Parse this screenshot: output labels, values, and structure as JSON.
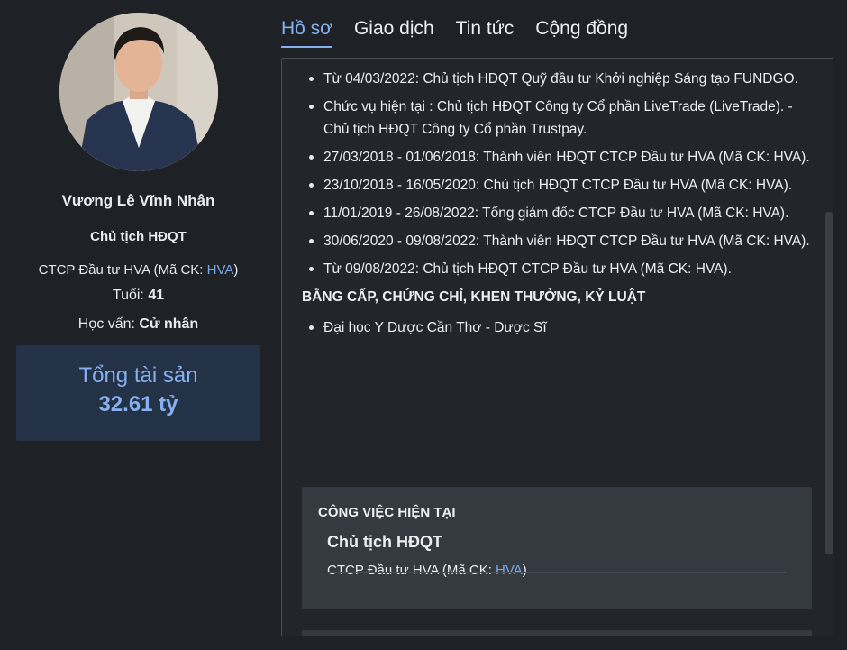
{
  "profile": {
    "name": "Vương Lê Vĩnh Nhân",
    "role": "Chủ tịch HĐQT",
    "company_prefix": "CTCP Đầu tư HVA (Mã CK: ",
    "company_ticker": "HVA",
    "company_suffix": ")",
    "age_label": "Tuổi: ",
    "age_value": "41",
    "education_label": "Học vấn: ",
    "education_value": "Cử nhân",
    "asset_label": "Tổng tài sản",
    "asset_value": "32.61 tỷ"
  },
  "tabs": [
    {
      "label": "Hồ sơ",
      "active": true
    },
    {
      "label": "Giao dịch",
      "active": false
    },
    {
      "label": "Tin tức",
      "active": false
    },
    {
      "label": "Cộng đồng",
      "active": false
    }
  ],
  "career": [
    "Từ 04/03/2022: Chủ tịch HĐQT Quỹ đầu tư Khởi nghiệp Sáng tạo FUNDGO.",
    "Chức vụ hiện tại : Chủ tịch HĐQT Công ty Cổ phần LiveTrade (LiveTrade). - Chủ tịch HĐQT Công ty Cổ phần Trustpay.",
    "27/03/2018 - 01/06/2018: Thành viên HĐQT CTCP Đầu tư HVA (Mã CK: HVA).",
    "23/10/2018 - 16/05/2020: Chủ tịch HĐQT CTCP Đầu tư HVA (Mã CK: HVA).",
    "11/01/2019 - 26/08/2022: Tổng giám đốc CTCP Đầu tư HVA (Mã CK: HVA).",
    "30/06/2020 - 09/08/2022: Thành viên HĐQT CTCP Đầu tư HVA (Mã CK: HVA).",
    "Từ 09/08/2022: Chủ tịch HĐQT CTCP Đầu tư HVA (Mã CK: HVA)."
  ],
  "credentials_heading": "BẰNG CẤP, CHỨNG CHỈ, KHEN THƯỞNG, KỶ LUẬT",
  "credentials": [
    "Đại học Y Dược Cần Thơ - Dược Sĩ"
  ],
  "current_job": {
    "heading": "CÔNG VIỆC HIỆN TẠI",
    "title": "Chủ tịch HĐQT",
    "company_prefix": "CTCP Đầu tư HVA (Mã CK: ",
    "company_ticker": "HVA",
    "company_suffix": ")"
  },
  "colors": {
    "background": "#1e2227",
    "accent": "#86b0ef",
    "asset_box": "#233247",
    "card": "#353a41"
  }
}
